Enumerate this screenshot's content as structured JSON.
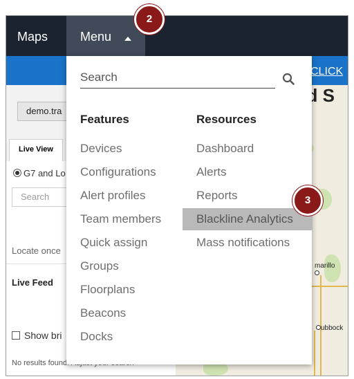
{
  "topbar": {
    "maps_label": "Maps",
    "menu_label": "Menu"
  },
  "banner": {
    "click_text": "CLICK"
  },
  "left_panel": {
    "domain_text": "demo.tra",
    "tab_live_view": "Live View",
    "radio_label": "G7 and Lo",
    "search_placeholder": "Search",
    "locate_text": "Locate once",
    "live_feed_title": "Live Feed",
    "show_label": "Show bri",
    "no_results": "No results found. Adjust your search"
  },
  "map": {
    "title_fragment": "ed S",
    "city_1": "marillo",
    "city_2": "ubbock"
  },
  "menu": {
    "search_placeholder": "Search",
    "features_heading": "Features",
    "resources_heading": "Resources",
    "features": [
      "Devices",
      "Configurations",
      "Alert profiles",
      "Team members",
      "Quick assign",
      "Groups",
      "Floorplans",
      "Beacons",
      "Docks"
    ],
    "resources": [
      "Dashboard",
      "Alerts",
      "Reports",
      "Blackline Analytics",
      "Mass notifications"
    ],
    "highlighted_item": "Blackline Analytics"
  },
  "callouts": {
    "step_menu": "2",
    "step_analytics": "3"
  },
  "colors": {
    "topbar": "#1b2330",
    "menu_active": "#404a58",
    "banner": "#1a73c9",
    "callout": "#8a1a1a",
    "highlight": "#b9b9b9"
  }
}
